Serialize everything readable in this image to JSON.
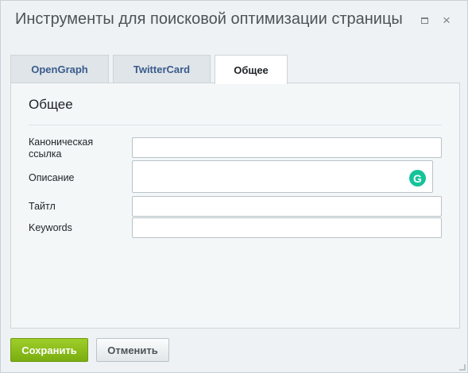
{
  "window": {
    "title": "Инструменты для поисковой оптимизации страницы",
    "maximize_icon": "maximize-icon",
    "close_icon": "close-icon",
    "close_glyph": "×"
  },
  "tabs": [
    {
      "label": "OpenGraph",
      "active": false
    },
    {
      "label": "TwitterCard",
      "active": false
    },
    {
      "label": "Общее",
      "active": true
    }
  ],
  "panel": {
    "title": "Общее",
    "fields": [
      {
        "label_line1": "Каноническая",
        "label_line2": "ссылка",
        "value": "",
        "type": "text"
      },
      {
        "label": "Описание",
        "value": "",
        "type": "textarea",
        "addon_icon": "grammarly-icon",
        "addon_glyph": "G"
      },
      {
        "label": "Тайтл",
        "value": "",
        "type": "text"
      },
      {
        "label": "Keywords",
        "value": "",
        "type": "text"
      }
    ]
  },
  "buttons": {
    "save": "Сохранить",
    "cancel": "Отменить"
  },
  "colors": {
    "save_button": "#8dbf1d",
    "tab_text": "#3b5b8c",
    "grammarly": "#15c39a"
  }
}
